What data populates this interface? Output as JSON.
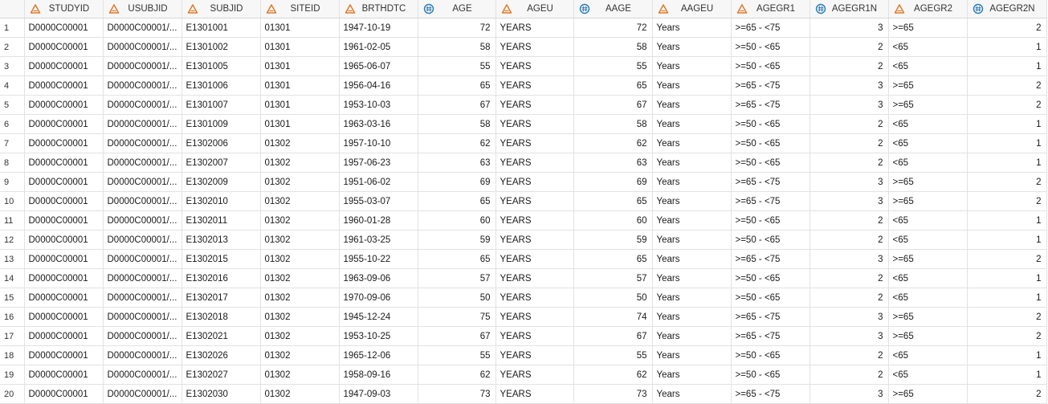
{
  "columns": [
    {
      "name": "",
      "type": "rownum"
    },
    {
      "name": "STUDYID",
      "type": "char",
      "icon": "character-column-icon"
    },
    {
      "name": "USUBJID",
      "type": "char",
      "icon": "character-column-icon"
    },
    {
      "name": "SUBJID",
      "type": "char",
      "icon": "character-column-icon"
    },
    {
      "name": "SITEID",
      "type": "char",
      "icon": "character-column-icon"
    },
    {
      "name": "BRTHDTC",
      "type": "char",
      "icon": "character-column-icon"
    },
    {
      "name": "AGE",
      "type": "num",
      "icon": "numeric-column-icon"
    },
    {
      "name": "AGEU",
      "type": "char",
      "icon": "character-column-icon"
    },
    {
      "name": "AAGE",
      "type": "num",
      "icon": "numeric-column-icon"
    },
    {
      "name": "AAGEU",
      "type": "char",
      "icon": "character-column-icon"
    },
    {
      "name": "AGEGR1",
      "type": "char",
      "icon": "character-column-icon"
    },
    {
      "name": "AGEGR1N",
      "type": "num",
      "icon": "numeric-column-icon"
    },
    {
      "name": "AGEGR2",
      "type": "char",
      "icon": "character-column-icon"
    },
    {
      "name": "AGEGR2N",
      "type": "num",
      "icon": "numeric-column-icon"
    }
  ],
  "colors": {
    "char_icon": "#e07a2c",
    "num_icon": "#2a7bb4"
  },
  "rows": [
    [
      "1",
      "D0000C00001",
      "D0000C00001/...",
      "E1301001",
      "01301",
      "1947-10-19",
      "72",
      "YEARS",
      "72",
      "Years",
      ">=65 - <75",
      "3",
      ">=65",
      "2"
    ],
    [
      "2",
      "D0000C00001",
      "D0000C00001/...",
      "E1301002",
      "01301",
      "1961-02-05",
      "58",
      "YEARS",
      "58",
      "Years",
      ">=50 - <65",
      "2",
      "<65",
      "1"
    ],
    [
      "3",
      "D0000C00001",
      "D0000C00001/...",
      "E1301005",
      "01301",
      "1965-06-07",
      "55",
      "YEARS",
      "55",
      "Years",
      ">=50 - <65",
      "2",
      "<65",
      "1"
    ],
    [
      "4",
      "D0000C00001",
      "D0000C00001/...",
      "E1301006",
      "01301",
      "1956-04-16",
      "65",
      "YEARS",
      "65",
      "Years",
      ">=65 - <75",
      "3",
      ">=65",
      "2"
    ],
    [
      "5",
      "D0000C00001",
      "D0000C00001/...",
      "E1301007",
      "01301",
      "1953-10-03",
      "67",
      "YEARS",
      "67",
      "Years",
      ">=65 - <75",
      "3",
      ">=65",
      "2"
    ],
    [
      "6",
      "D0000C00001",
      "D0000C00001/...",
      "E1301009",
      "01301",
      "1963-03-16",
      "58",
      "YEARS",
      "58",
      "Years",
      ">=50 - <65",
      "2",
      "<65",
      "1"
    ],
    [
      "7",
      "D0000C00001",
      "D0000C00001/...",
      "E1302006",
      "01302",
      "1957-10-10",
      "62",
      "YEARS",
      "62",
      "Years",
      ">=50 - <65",
      "2",
      "<65",
      "1"
    ],
    [
      "8",
      "D0000C00001",
      "D0000C00001/...",
      "E1302007",
      "01302",
      "1957-06-23",
      "63",
      "YEARS",
      "63",
      "Years",
      ">=50 - <65",
      "2",
      "<65",
      "1"
    ],
    [
      "9",
      "D0000C00001",
      "D0000C00001/...",
      "E1302009",
      "01302",
      "1951-06-02",
      "69",
      "YEARS",
      "69",
      "Years",
      ">=65 - <75",
      "3",
      ">=65",
      "2"
    ],
    [
      "10",
      "D0000C00001",
      "D0000C00001/...",
      "E1302010",
      "01302",
      "1955-03-07",
      "65",
      "YEARS",
      "65",
      "Years",
      ">=65 - <75",
      "3",
      ">=65",
      "2"
    ],
    [
      "11",
      "D0000C00001",
      "D0000C00001/...",
      "E1302011",
      "01302",
      "1960-01-28",
      "60",
      "YEARS",
      "60",
      "Years",
      ">=50 - <65",
      "2",
      "<65",
      "1"
    ],
    [
      "12",
      "D0000C00001",
      "D0000C00001/...",
      "E1302013",
      "01302",
      "1961-03-25",
      "59",
      "YEARS",
      "59",
      "Years",
      ">=50 - <65",
      "2",
      "<65",
      "1"
    ],
    [
      "13",
      "D0000C00001",
      "D0000C00001/...",
      "E1302015",
      "01302",
      "1955-10-22",
      "65",
      "YEARS",
      "65",
      "Years",
      ">=65 - <75",
      "3",
      ">=65",
      "2"
    ],
    [
      "14",
      "D0000C00001",
      "D0000C00001/...",
      "E1302016",
      "01302",
      "1963-09-06",
      "57",
      "YEARS",
      "57",
      "Years",
      ">=50 - <65",
      "2",
      "<65",
      "1"
    ],
    [
      "15",
      "D0000C00001",
      "D0000C00001/...",
      "E1302017",
      "01302",
      "1970-09-06",
      "50",
      "YEARS",
      "50",
      "Years",
      ">=50 - <65",
      "2",
      "<65",
      "1"
    ],
    [
      "16",
      "D0000C00001",
      "D0000C00001/...",
      "E1302018",
      "01302",
      "1945-12-24",
      "75",
      "YEARS",
      "74",
      "Years",
      ">=65 - <75",
      "3",
      ">=65",
      "2"
    ],
    [
      "17",
      "D0000C00001",
      "D0000C00001/...",
      "E1302021",
      "01302",
      "1953-10-25",
      "67",
      "YEARS",
      "67",
      "Years",
      ">=65 - <75",
      "3",
      ">=65",
      "2"
    ],
    [
      "18",
      "D0000C00001",
      "D0000C00001/...",
      "E1302026",
      "01302",
      "1965-12-06",
      "55",
      "YEARS",
      "55",
      "Years",
      ">=50 - <65",
      "2",
      "<65",
      "1"
    ],
    [
      "19",
      "D0000C00001",
      "D0000C00001/...",
      "E1302027",
      "01302",
      "1958-09-16",
      "62",
      "YEARS",
      "62",
      "Years",
      ">=50 - <65",
      "2",
      "<65",
      "1"
    ],
    [
      "20",
      "D0000C00001",
      "D0000C00001/...",
      "E1302030",
      "01302",
      "1947-09-03",
      "73",
      "YEARS",
      "73",
      "Years",
      ">=65 - <75",
      "3",
      ">=65",
      "2"
    ]
  ]
}
